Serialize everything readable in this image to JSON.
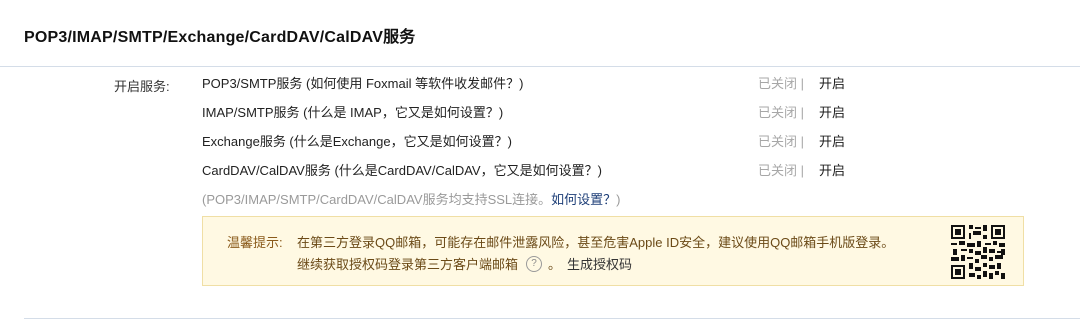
{
  "section": {
    "title": "POP3/IMAP/SMTP/Exchange/CardDAV/CalDAV服务"
  },
  "services_label": "开启服务:",
  "services": [
    {
      "name": "POP3/SMTP服务 (如何使用 Foxmail 等软件收发邮件？)",
      "status": "已关闭 |",
      "action": "开启"
    },
    {
      "name": "IMAP/SMTP服务 (什么是 IMAP，它又是如何设置？)",
      "status": "已关闭 |",
      "action": "开启"
    },
    {
      "name": "Exchange服务 (什么是Exchange，它又是如何设置？)",
      "status": "已关闭 |",
      "action": "开启"
    },
    {
      "name": "CardDAV/CalDAV服务 (什么是CardDAV/CalDAV，它又是如何设置？)",
      "status": "已关闭 |",
      "action": "开启"
    }
  ],
  "ssl_note": {
    "text": "(POP3/IMAP/SMTP/CardDAV/CalDAV服务均支持SSL连接。",
    "link": "如何设置？",
    "close": ")"
  },
  "tip": {
    "label": "温馨提示:",
    "line1": "在第三方登录QQ邮箱，可能存在邮件泄露风险，甚至危害Apple ID安全，建议使用QQ邮箱手机版登录。",
    "line2": "继续获取授权码登录第三方客户端邮箱",
    "help_glyph": "?",
    "line2_suffix": "。",
    "generate_link": "生成授权码",
    "qr_icon": "qr-code-icon"
  }
}
